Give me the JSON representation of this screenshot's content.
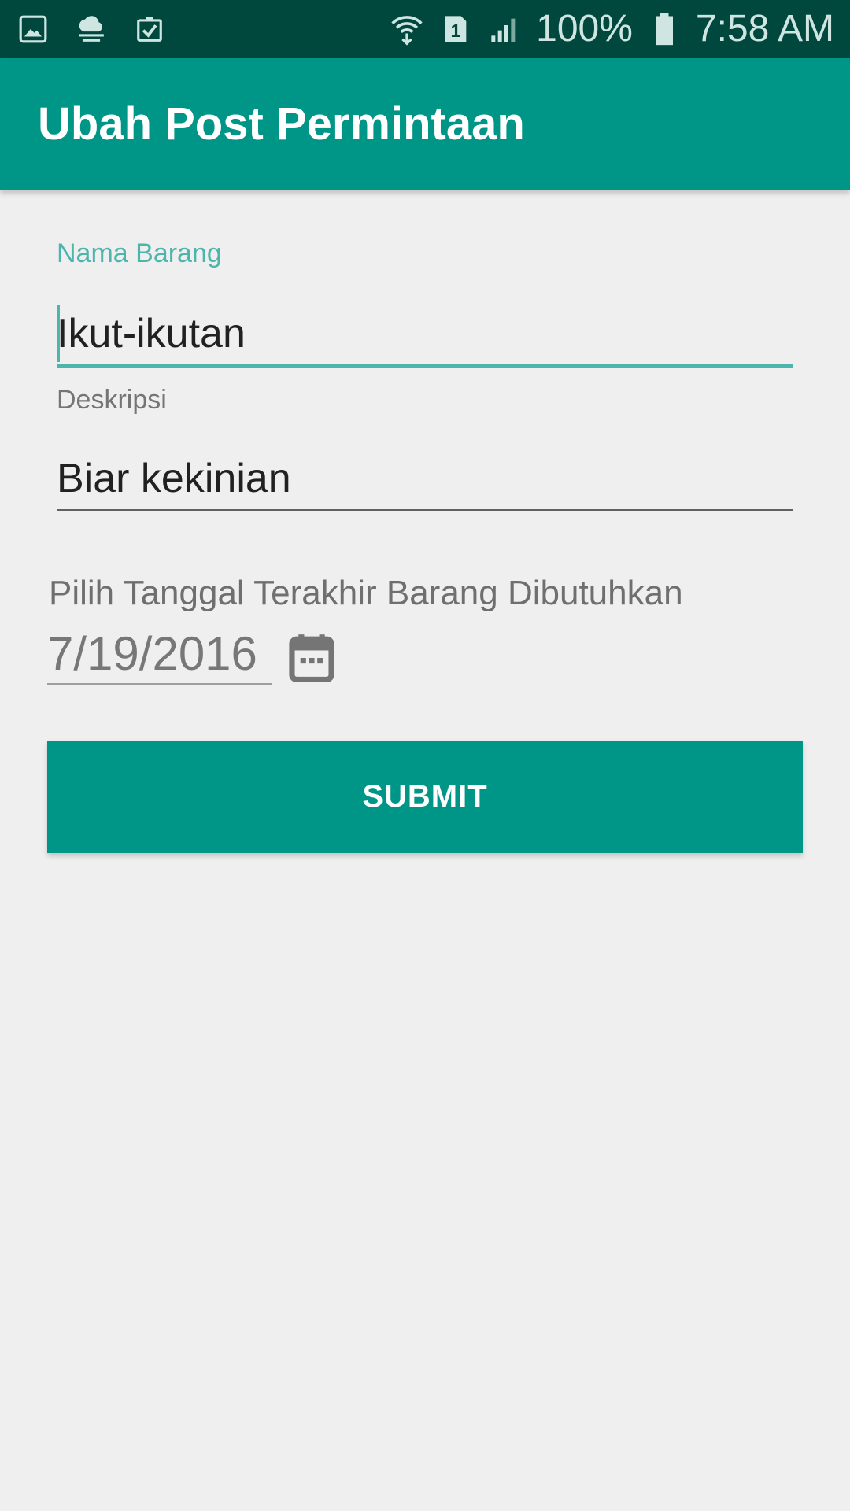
{
  "status_bar": {
    "left_icons": [
      "gallery-icon",
      "cloud-icon",
      "clipboard-check-icon"
    ],
    "right_icons": [
      "wifi-icon",
      "sim-1-icon",
      "signal-icon",
      "battery-icon"
    ],
    "battery_percent": "100%",
    "time": "7:58 AM"
  },
  "app_bar": {
    "title": "Ubah Post Permintaan"
  },
  "form": {
    "nama_barang": {
      "label": "Nama Barang",
      "value": "Ikut-ikutan"
    },
    "deskripsi": {
      "label": "Deskripsi",
      "value": "Biar kekinian"
    },
    "tanggal": {
      "prompt": "Pilih Tanggal Terakhir Barang Dibutuhkan",
      "value": "7/19/2016",
      "icon": "calendar-icon"
    },
    "submit_label": "SUBMIT"
  },
  "colors": {
    "status_bar": "#00483d",
    "primary": "#009687",
    "accent": "#4db6ac",
    "background": "#efefef"
  }
}
